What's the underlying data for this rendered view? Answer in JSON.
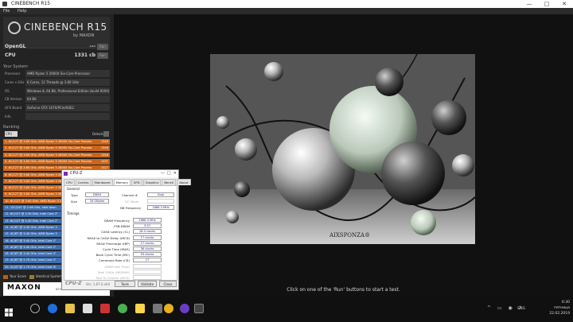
{
  "window": {
    "title": "CINEBENCH R15",
    "controls": [
      "—",
      "□",
      "✕"
    ]
  },
  "menu": [
    "File",
    "Help"
  ],
  "logo": {
    "title": "CINEBENCH R15",
    "sub": "by MAXON"
  },
  "benchmarks": [
    {
      "label": "OpenGL",
      "value": "---",
      "button": "Run"
    },
    {
      "label": "CPU",
      "value": "1331 cb",
      "button": "Run"
    }
  ],
  "system": {
    "heading": "Your System",
    "rows": [
      {
        "k": "Processor",
        "v": "AMD Ryzen 5 2600X Six-Core Processor"
      },
      {
        "k": "Cores x GHz",
        "v": "6 Cores, 12 Threads @ 3.60 GHz"
      },
      {
        "k": "OS",
        "v": "Windows 8, 64 Bit, Professional Edition (build 9200)"
      },
      {
        "k": "CB Version",
        "v": "64 Bit"
      },
      {
        "k": "GFX Board",
        "v": "GeForce GTX 1070/PCIe/SSE2"
      },
      {
        "k": "Info",
        "v": ""
      }
    ]
  },
  "ranking": {
    "heading": "Ranking",
    "select": "CPU",
    "details": "Details",
    "rows": [
      {
        "name": "1. 6C/12T @ 3.60 GHz, AMD Ryzen 5 2600X Six-Core Process",
        "score": "1346",
        "kind": "orange"
      },
      {
        "name": "2. 6C/12T @ 3.60 GHz, AMD Ryzen 5 2600X Six-Core Process",
        "score": "1346",
        "kind": "orange"
      },
      {
        "name": "3. 6C/12T @ 3.60 GHz, AMD Ryzen 5 2600X Six-Core Process",
        "score": "1346",
        "kind": "orange"
      },
      {
        "name": "4. 6C/12T @ 3.60 GHz, AMD Ryzen 5 2600X Six-Core Process",
        "score": "1331",
        "kind": "orange"
      },
      {
        "name": "5. 6C/12T @ 3.60 GHz, AMD Ryzen 5 2600X Six-Core Process",
        "score": "1327",
        "kind": "orange"
      },
      {
        "name": "6. 6C/12T @ 3.60 GHz, AMD Ryzen 5 2600X Six-Core Process",
        "score": "",
        "kind": "orange"
      },
      {
        "name": "7. 6C/12T @ 3.60 GHz, AMD Ryzen 5 2600X Six-Core Process",
        "score": "",
        "kind": "orange"
      },
      {
        "name": "8. 6C/12T @ 3.60 GHz, AMD Ryzen 5 2600X Six-Core Process",
        "score": "",
        "kind": "orange"
      },
      {
        "name": "9. 6C/12T @ 3.60 GHz, AMD Ryzen 5 2600X Six-Core Process",
        "score": "",
        "kind": "orange"
      },
      {
        "name": "10. 6C/12T @ 3.60 GHz, AMD Ryzen 5 2600X Six-Core Process",
        "score": "",
        "kind": "orange"
      },
      {
        "name": "11. 12C/24T @ 2.66 GHz, Intel Xeon",
        "score": "",
        "kind": "blue"
      },
      {
        "name": "12. 6C/12T @ 3.30 GHz, Intel Core i7",
        "score": "",
        "kind": "blue"
      },
      {
        "name": "13. 6C/12T @ 4.40 GHz, Intel Core i7",
        "score": "",
        "kind": "blue"
      },
      {
        "name": "14. 4C/8T @ 3.40 GHz, AMD Ryzen 5",
        "score": "",
        "kind": "blue"
      },
      {
        "name": "15. 4C/8T @ 3.40 GHz, AMD Ryzen 5",
        "score": "",
        "kind": "blue"
      },
      {
        "name": "16. 4C/8T @ 3.40 GHz, Intel Core i7",
        "score": "",
        "kind": "blue"
      },
      {
        "name": "17. 4C/8T @ 3.40 GHz, Intel Core i7",
        "score": "",
        "kind": "blue"
      },
      {
        "name": "18. 4C/8T @ 3.40 GHz, Intel Core i7",
        "score": "",
        "kind": "blue"
      },
      {
        "name": "19. 4C/8T @ 2.70 GHz, Intel Core i7",
        "score": "",
        "kind": "blue"
      },
      {
        "name": "20. 2C/4T @ 1.70 GHz, Intel Core i5",
        "score": "",
        "kind": "blue"
      }
    ],
    "legend": [
      {
        "label": "Your Score",
        "color": "#b5601a"
      },
      {
        "label": "Identical System",
        "color": "#9a7a3a"
      }
    ]
  },
  "maxon": {
    "title": "MAXON",
    "tag": "BEYOND THE REAL WORLD"
  },
  "render": {
    "brand": "AIXSPONZA®"
  },
  "status": "Click on one of the 'Run' buttons to start a test.",
  "cpuz": {
    "title": "CPU-Z",
    "tabs": [
      "CPU",
      "Caches",
      "Mainboard",
      "Memory",
      "SPD",
      "Graphics",
      "Bench",
      "About"
    ],
    "active_tab": "Memory",
    "general_label": "General",
    "type_label": "Type",
    "type": "DDR4",
    "size_label": "Size",
    "size": "16 GBytes",
    "channel_label": "Channel #",
    "channel": "Dual",
    "dcmode_label": "DC Mode",
    "dcmode": "",
    "nbfreq_label": "NB Frequency",
    "nbfreq": "1666.3 MHz",
    "timings_label": "Timings",
    "timings": [
      {
        "k": "DRAM Frequency",
        "v": "1666.3 MHz"
      },
      {
        "k": "FSB:DRAM",
        "v": "3:57"
      },
      {
        "k": "CAS# Latency (CL)",
        "v": "16.0 clocks"
      },
      {
        "k": "RAS# to CAS# Delay (tRCD)",
        "v": "17 clocks"
      },
      {
        "k": "RAS# Precharge (tRP)",
        "v": "17 clocks"
      },
      {
        "k": "Cycle Time (tRAS)",
        "v": "36 clocks"
      },
      {
        "k": "Bank Cycle Time (tRC)",
        "v": "53 clocks"
      },
      {
        "k": "Command Rate (CR)",
        "v": "1T"
      },
      {
        "k": "DRAM Idle Timer",
        "v": ""
      },
      {
        "k": "Total CAS# (tRDRAM)",
        "v": ""
      },
      {
        "k": "Row To Column (tRCD)",
        "v": ""
      }
    ],
    "brand": "CPU-Z",
    "version": "Ver. 1.87.0.x64",
    "tools": "Tools",
    "validate": "Validate",
    "close": "Close"
  },
  "taskbar": {
    "lang": "ENG",
    "time": "6:30",
    "day": "пятница",
    "date": "22.02.2019"
  }
}
